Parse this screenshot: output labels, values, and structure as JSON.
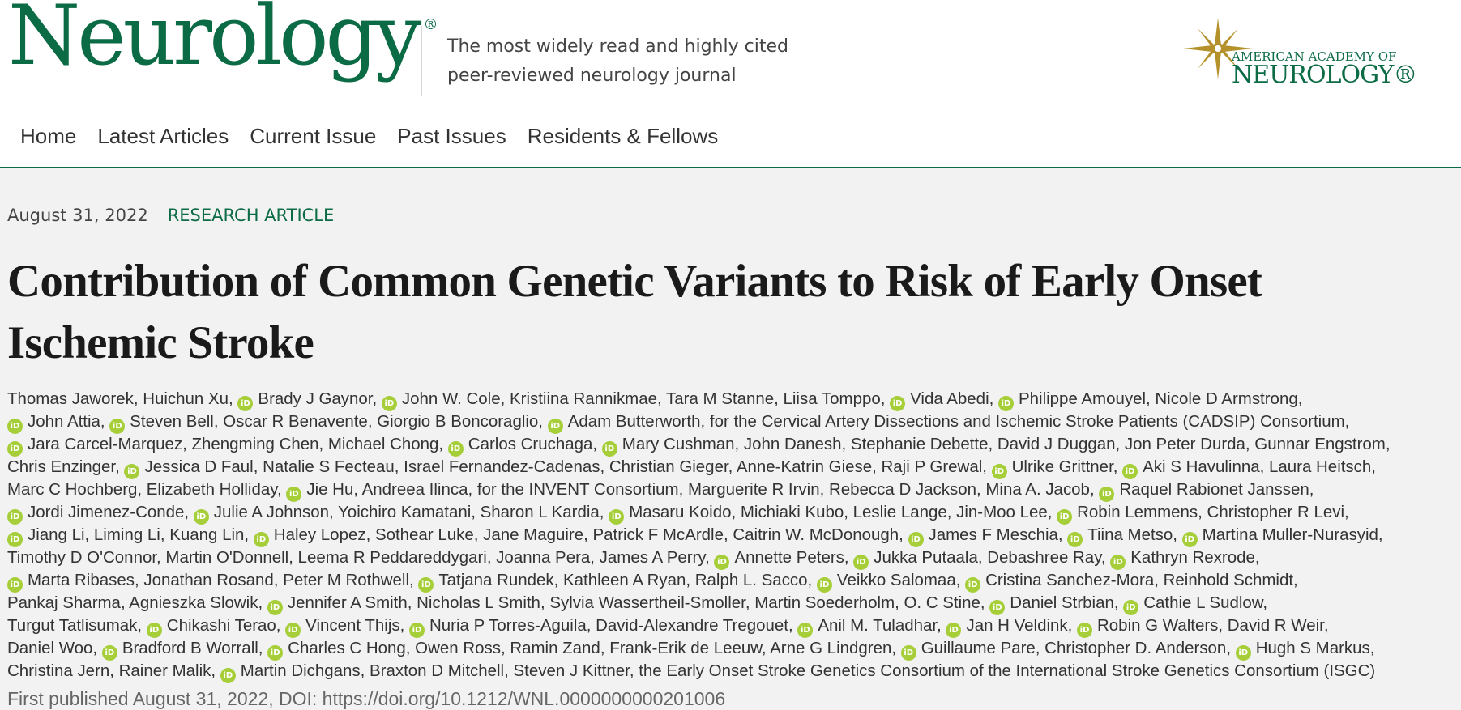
{
  "header": {
    "logo_text": "Neurology",
    "logo_mark": "®",
    "tagline_line1": "The most widely read and highly cited",
    "tagline_line2": "peer-reviewed neurology journal",
    "aan_line1": "AMERICAN ACADEMY OF",
    "aan_line2": "NEUROLOGY®"
  },
  "nav": {
    "items": [
      {
        "label": "Home"
      },
      {
        "label": "Latest Articles"
      },
      {
        "label": "Current Issue"
      },
      {
        "label": "Past Issues"
      },
      {
        "label": "Residents & Fellows"
      }
    ]
  },
  "article": {
    "date": "August 31, 2022",
    "type": "RESEARCH ARTICLE",
    "title": "Contribution of Common Genetic Variants to Risk of Early Onset Ischemic Stroke",
    "orcid_icon_label": "iD",
    "first_published_label": "First published August 31, 2022, DOI: ",
    "doi_url": "https://doi.org/10.1212/WNL.0000000000201006",
    "author_lines": [
      [
        {
          "t": "Thomas Jaworek, Huichun Xu, ",
          "o": false
        },
        {
          "t": "Brady J Gaynor, ",
          "o": true
        },
        {
          "t": "John W. Cole, Kristiina Rannikmae, Tara M Stanne, Liisa Tomppo, ",
          "o": true
        },
        {
          "t": "Vida Abedi, ",
          "o": true
        },
        {
          "t": "Philippe Amouyel, Nicole D Armstrong,",
          "o": true
        }
      ],
      [
        {
          "t": "John Attia, ",
          "o": true
        },
        {
          "t": "Steven Bell, Oscar R Benavente, Giorgio B Boncoraglio, ",
          "o": true
        },
        {
          "t": "Adam Butterworth, for the Cervical Artery Dissections and Ischemic Stroke Patients (CADSIP) Consortium,",
          "o": true
        }
      ],
      [
        {
          "t": "Jara Carcel-Marquez, Zhengming Chen, Michael Chong, ",
          "o": true
        },
        {
          "t": "Carlos Cruchaga, ",
          "o": true
        },
        {
          "t": "Mary Cushman, John Danesh, Stephanie Debette, David J Duggan, Jon Peter Durda, Gunnar Engstrom,",
          "o": true
        }
      ],
      [
        {
          "t": "Chris Enzinger, ",
          "o": false
        },
        {
          "t": "Jessica D Faul, Natalie S Fecteau, Israel Fernandez-Cadenas, Christian Gieger, Anne-Katrin Giese, Raji P Grewal, ",
          "o": true
        },
        {
          "t": "Ulrike Grittner, ",
          "o": true
        },
        {
          "t": "Aki S Havulinna, Laura Heitsch,",
          "o": true
        }
      ],
      [
        {
          "t": "Marc C Hochberg, Elizabeth Holliday, ",
          "o": false
        },
        {
          "t": "Jie Hu, Andreea Ilinca, for the INVENT Consortium, Marguerite R Irvin, Rebecca D Jackson, Mina A. Jacob, ",
          "o": true
        },
        {
          "t": "Raquel Rabionet Janssen,",
          "o": true
        }
      ],
      [
        {
          "t": "Jordi Jimenez-Conde, ",
          "o": true
        },
        {
          "t": "Julie A Johnson, Yoichiro Kamatani, Sharon L Kardia, ",
          "o": true
        },
        {
          "t": "Masaru Koido, Michiaki Kubo, Leslie Lange, Jin-Moo Lee, ",
          "o": true
        },
        {
          "t": "Robin Lemmens, Christopher R Levi,",
          "o": true
        }
      ],
      [
        {
          "t": "Jiang Li, Liming Li, Kuang Lin, ",
          "o": true
        },
        {
          "t": "Haley Lopez, Sothear Luke, Jane Maguire, Patrick F McArdle, Caitrin W. McDonough, ",
          "o": true
        },
        {
          "t": "James F Meschia, ",
          "o": true
        },
        {
          "t": "Tiina Metso, ",
          "o": true
        },
        {
          "t": "Martina Muller-Nurasyid,",
          "o": true
        }
      ],
      [
        {
          "t": "Timothy D O'Connor, Martin O'Donnell, Leema R Peddareddygari, Joanna Pera, James A Perry, ",
          "o": false
        },
        {
          "t": "Annette Peters, ",
          "o": true
        },
        {
          "t": "Jukka Putaala, Debashree Ray, ",
          "o": true
        },
        {
          "t": "Kathryn Rexrode,",
          "o": true
        }
      ],
      [
        {
          "t": "Marta Ribases, Jonathan Rosand, Peter M Rothwell, ",
          "o": true
        },
        {
          "t": "Tatjana Rundek, Kathleen A Ryan, Ralph L. Sacco, ",
          "o": true
        },
        {
          "t": "Veikko Salomaa, ",
          "o": true
        },
        {
          "t": "Cristina Sanchez-Mora, Reinhold Schmidt,",
          "o": true
        }
      ],
      [
        {
          "t": "Pankaj Sharma, Agnieszka Slowik, ",
          "o": false
        },
        {
          "t": "Jennifer A Smith, Nicholas L Smith, Sylvia Wassertheil-Smoller, Martin Soederholm, O. C Stine, ",
          "o": true
        },
        {
          "t": "Daniel Strbian, ",
          "o": true
        },
        {
          "t": "Cathie L Sudlow,",
          "o": true
        }
      ],
      [
        {
          "t": "Turgut Tatlisumak, ",
          "o": false
        },
        {
          "t": "Chikashi Terao, ",
          "o": true
        },
        {
          "t": "Vincent Thijs, ",
          "o": true
        },
        {
          "t": "Nuria P Torres-Aguila, David-Alexandre Tregouet, ",
          "o": true
        },
        {
          "t": "Anil M. Tuladhar, ",
          "o": true
        },
        {
          "t": "Jan H Veldink, ",
          "o": true
        },
        {
          "t": "Robin G Walters, David R Weir,",
          "o": true
        }
      ],
      [
        {
          "t": "Daniel Woo, ",
          "o": false
        },
        {
          "t": "Bradford B Worrall, ",
          "o": true
        },
        {
          "t": "Charles C Hong, Owen Ross, Ramin Zand, Frank-Erik de Leeuw, Arne G Lindgren, ",
          "o": true
        },
        {
          "t": "Guillaume Pare, Christopher D. Anderson, ",
          "o": true
        },
        {
          "t": "Hugh S Markus,",
          "o": true
        }
      ],
      [
        {
          "t": "Christina Jern, Rainer Malik, ",
          "o": false
        },
        {
          "t": "Martin Dichgans, Braxton D Mitchell, Steven J Kittner, the Early Onset Stroke Genetics Consortium of the International Stroke Genetics Consortium (ISGC)",
          "o": true
        }
      ]
    ]
  }
}
